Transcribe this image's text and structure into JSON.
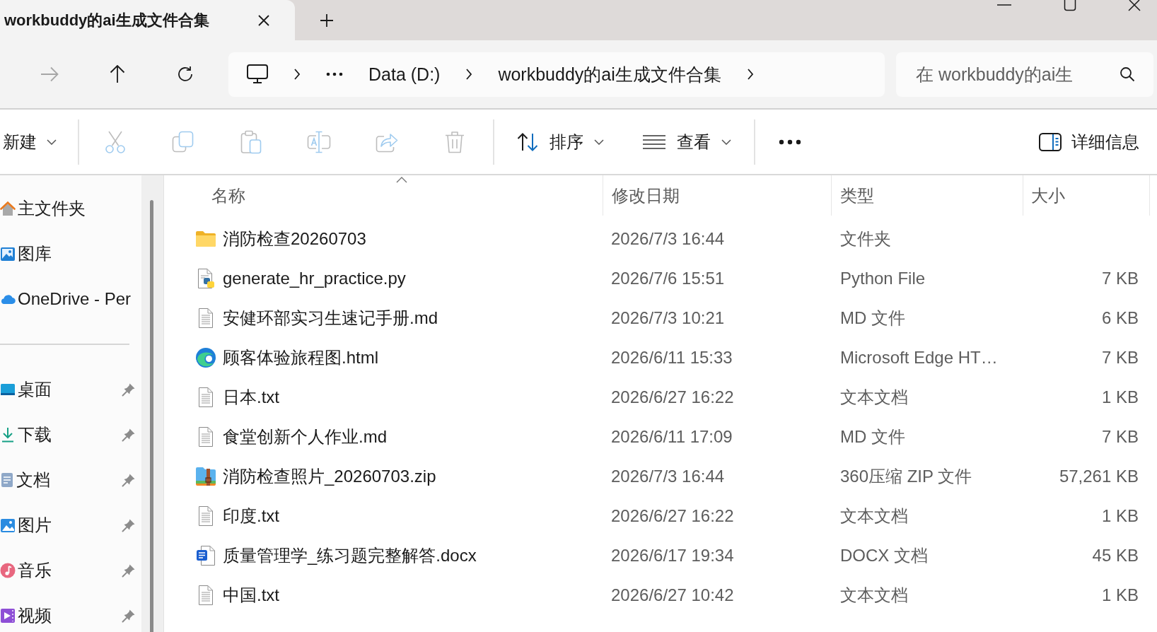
{
  "tabs": [
    {
      "title": "workbuddy的ai生成文件合集",
      "selected": true
    }
  ],
  "nav_buttons": [
    {
      "kind": "forward",
      "disabled": true
    },
    {
      "kind": "up",
      "disabled": false
    },
    {
      "kind": "refresh",
      "disabled": false
    }
  ],
  "address_bar": {
    "crumbs": [
      {
        "kind": "device"
      },
      {
        "kind": "overflow"
      },
      {
        "kind": "folder",
        "label": "Data (D:)"
      },
      {
        "kind": "folder",
        "label": "workbuddy的ai生成文件合集"
      }
    ]
  },
  "search": {
    "placeholder": "在 workbuddy的ai生"
  },
  "toolbar": {
    "new_menu": {
      "label": "新建"
    },
    "actions": [
      {
        "kind": "cut",
        "disabled": true
      },
      {
        "kind": "copy",
        "disabled": true
      },
      {
        "kind": "paste",
        "disabled": true
      },
      {
        "kind": "rename",
        "disabled": true
      },
      {
        "kind": "share",
        "disabled": true
      },
      {
        "kind": "delete",
        "disabled": true
      }
    ],
    "sort_menu": {
      "label": "排序"
    },
    "view_menu": {
      "label": "查看"
    },
    "details_pane": {
      "label": "详细信息"
    }
  },
  "sidebar": {
    "groups": [
      {
        "items": [
          {
            "kind": "home",
            "label": "主文件夹",
            "selected": false
          },
          {
            "kind": "gallery",
            "label": "图库",
            "selected": false
          },
          {
            "kind": "cloud",
            "label": "OneDrive - Per",
            "selected": false
          }
        ]
      },
      {
        "items": [
          {
            "kind": "desktop",
            "label": "桌面",
            "pinned": true,
            "selected": false
          },
          {
            "kind": "download",
            "label": "下载",
            "pinned": true,
            "selected": false
          },
          {
            "kind": "documents",
            "label": "文档",
            "pinned": true,
            "selected": false
          },
          {
            "kind": "pictures",
            "label": "图片",
            "pinned": true,
            "selected": false
          },
          {
            "kind": "music",
            "label": "音乐",
            "pinned": true,
            "selected": false
          },
          {
            "kind": "videos",
            "label": "视频",
            "pinned": true,
            "selected": false
          }
        ]
      }
    ]
  },
  "file_list": {
    "columns": [
      {
        "label": "名称",
        "sorted": true
      },
      {
        "label": "修改日期",
        "sorted": false
      },
      {
        "label": "类型",
        "sorted": false
      },
      {
        "label": "大小",
        "sorted": false
      }
    ],
    "rows": [
      {
        "kind": "folder",
        "name": "消防检查20260703",
        "modified": "2026/7/3 16:44",
        "type": "文件夹",
        "selected": false
      },
      {
        "kind": "python",
        "name": "generate_hr_practice.py",
        "modified": "2026/7/6 15:51",
        "type": "Python File",
        "size": "7 KB",
        "selected": false
      },
      {
        "kind": "text",
        "name": "安健环部实习生速记手册.md",
        "modified": "2026/7/3 10:21",
        "type": "MD 文件",
        "size": "6 KB",
        "selected": false
      },
      {
        "kind": "edge",
        "name": "顾客体验旅程图.html",
        "modified": "2026/6/11 15:33",
        "type": "Microsoft Edge HT…",
        "size": "7 KB",
        "selected": false
      },
      {
        "kind": "text",
        "name": "日本.txt",
        "modified": "2026/6/27 16:22",
        "type": "文本文档",
        "size": "1 KB",
        "selected": false
      },
      {
        "kind": "text",
        "name": "食堂创新个人作业.md",
        "modified": "2026/6/11 17:09",
        "type": "MD 文件",
        "size": "7 KB",
        "selected": false
      },
      {
        "kind": "zip",
        "name": "消防检查照片_20260703.zip",
        "modified": "2026/7/3 16:44",
        "type": "360压缩 ZIP 文件",
        "size": "57,261 KB",
        "selected": false
      },
      {
        "kind": "text",
        "name": "印度.txt",
        "modified": "2026/6/27 16:22",
        "type": "文本文档",
        "size": "1 KB",
        "selected": false
      },
      {
        "kind": "word",
        "name": "质量管理学_练习题完整解答.docx",
        "modified": "2026/6/17 19:34",
        "type": "DOCX 文档",
        "size": "45 KB",
        "selected": false
      },
      {
        "kind": "text",
        "name": "中国.txt",
        "modified": "2026/6/27 10:42",
        "type": "文本文档",
        "size": "1 KB",
        "selected": false
      }
    ]
  }
}
